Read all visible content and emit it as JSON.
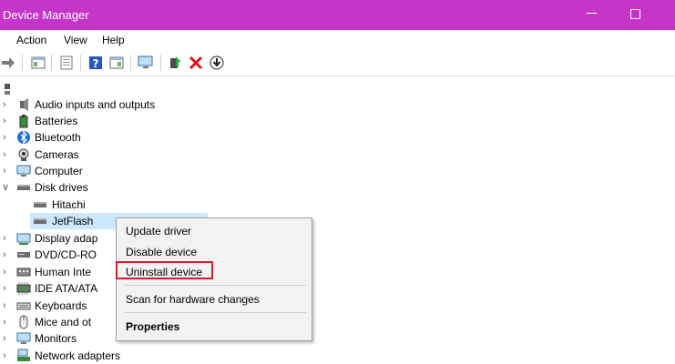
{
  "window": {
    "title": "Device Manager"
  },
  "menu": [
    "Action",
    "View",
    "Help"
  ],
  "toolbar": [
    "forward-icon",
    "properties-icon",
    "show-hide-icon",
    "help-icon",
    "properties-window-icon",
    "monitor-scan-icon",
    "add-driver-icon",
    "remove-icon",
    "update-driver-icon"
  ],
  "tree": [
    {
      "label": "Audio inputs and outputs",
      "icon": "speaker-icon",
      "expanded": false
    },
    {
      "label": "Batteries",
      "icon": "battery-icon",
      "expanded": false
    },
    {
      "label": "Bluetooth",
      "icon": "bluetooth-icon",
      "expanded": false
    },
    {
      "label": "Cameras",
      "icon": "camera-icon",
      "expanded": false
    },
    {
      "label": "Computer",
      "icon": "computer-icon",
      "expanded": false
    },
    {
      "label": "Disk drives",
      "icon": "disk-drive-icon",
      "expanded": true
    },
    {
      "label": "Hitachi",
      "icon": "disk-drive-icon",
      "child": true
    },
    {
      "label": "JetFlash",
      "icon": "disk-drive-icon",
      "child": true,
      "selected": true
    },
    {
      "label": "Display adap",
      "icon": "display-adapter-icon",
      "expanded": false
    },
    {
      "label": "DVD/CD-RO",
      "icon": "dvd-icon",
      "expanded": false
    },
    {
      "label": "Human Inte",
      "icon": "hid-icon",
      "expanded": false
    },
    {
      "label": "IDE ATA/ATA",
      "icon": "ide-icon",
      "expanded": false
    },
    {
      "label": "Keyboards",
      "icon": "keyboard-icon",
      "expanded": false
    },
    {
      "label": "Mice and ot",
      "icon": "mouse-icon",
      "expanded": false
    },
    {
      "label": "Monitors",
      "icon": "monitor-icon",
      "expanded": false
    },
    {
      "label": "Network adapters",
      "icon": "network-icon",
      "expanded": false
    }
  ],
  "context_menu": {
    "items": [
      "Update driver",
      "Disable device",
      "Uninstall device",
      "Scan for hardware changes",
      "Properties"
    ],
    "highlighted": "Uninstall device"
  },
  "colors": {
    "titlebar": "#c435c8",
    "selection": "#cce8ff",
    "highlight_border": "#d0202a"
  }
}
